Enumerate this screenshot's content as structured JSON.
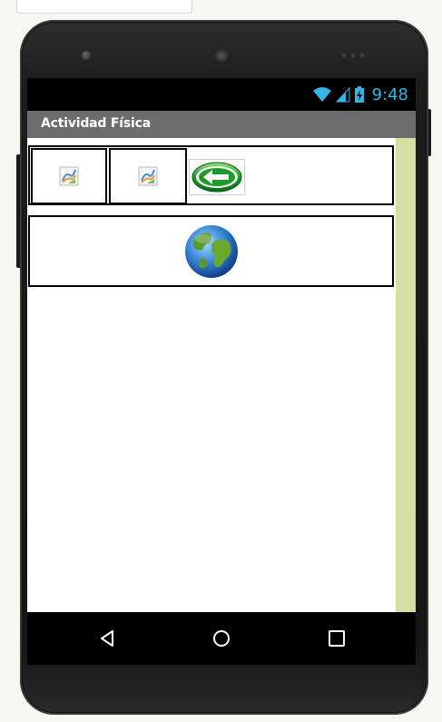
{
  "status_bar": {
    "time": "9:48"
  },
  "app_bar": {
    "title": "Actividad Física"
  },
  "icons": {
    "image_1": "broken-image-icon",
    "image_2": "broken-image-icon",
    "back_button": "green-back-arrow-icon",
    "globe": "globe-icon",
    "nav_back": "nav-back-icon",
    "nav_home": "nav-home-icon",
    "nav_recent": "nav-recent-apps-icon"
  },
  "colors": {
    "status_time": "#33b5e5",
    "title_bar": "#6d6d6d",
    "scroll_strip": "#d4dfa4"
  }
}
